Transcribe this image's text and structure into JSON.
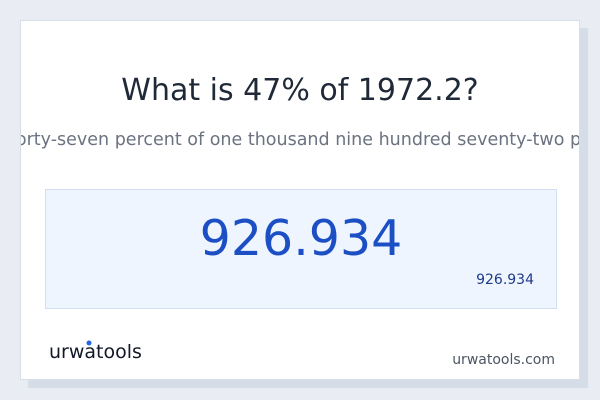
{
  "question": "What is 47% of 1972.2?",
  "spelled_out": "What is forty-seven percent of one thousand nine hundred seventy-two point two?",
  "result": {
    "value_large": "926.934",
    "value_small": "926.934"
  },
  "brand": {
    "logo_text": "urwatools",
    "site": "urwatools.com"
  },
  "colors": {
    "accent": "#1d4fc4",
    "box_bg": "#eef5ff",
    "logo_dot": "#2563eb"
  }
}
